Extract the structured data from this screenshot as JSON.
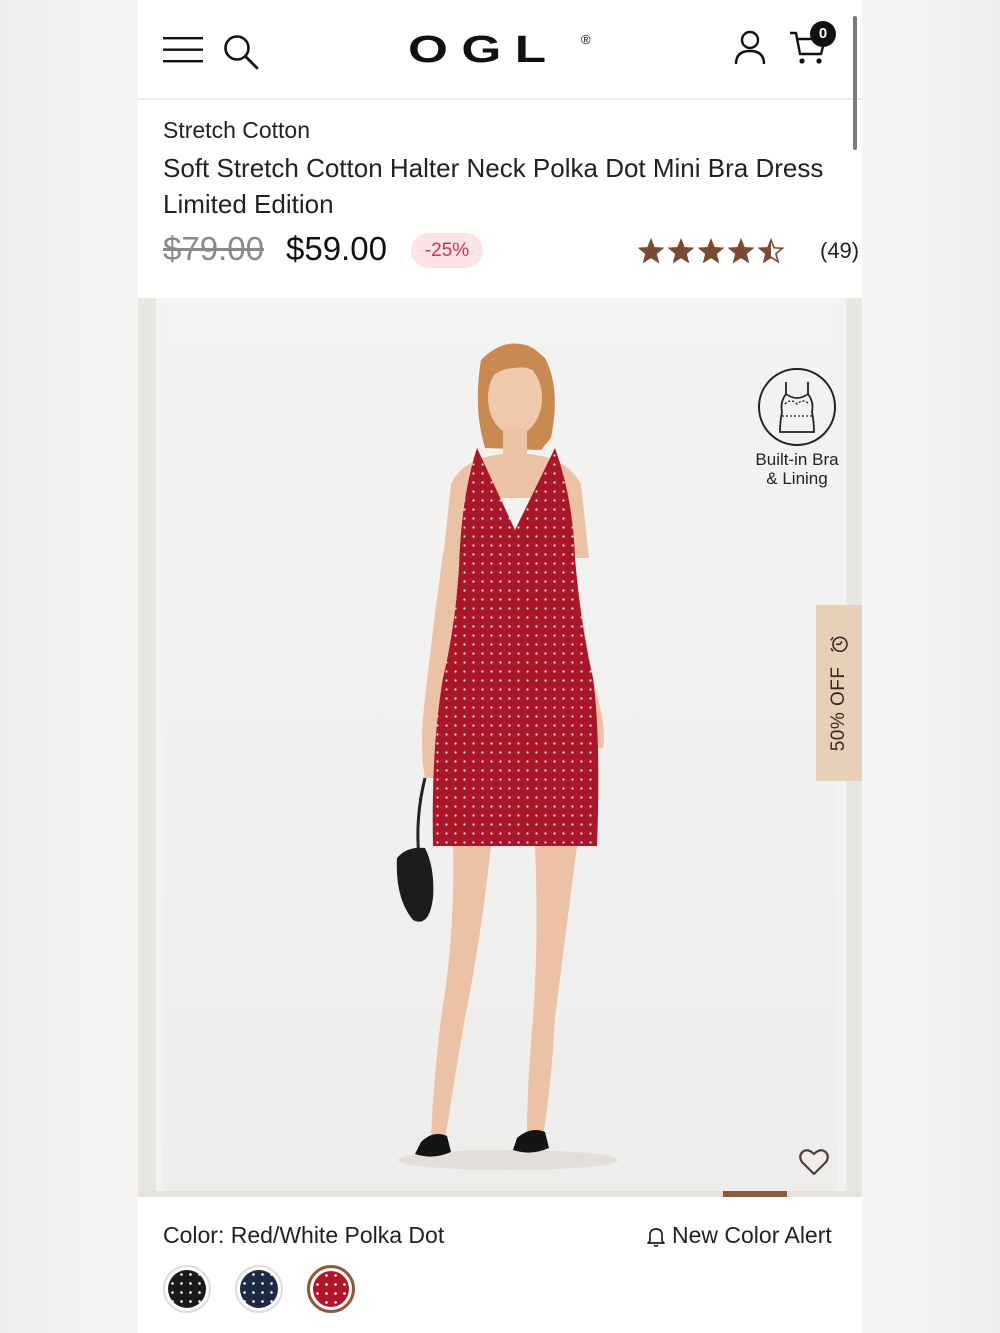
{
  "header": {
    "logo_text": "OGL",
    "logo_mark": "®",
    "cart_count": "0",
    "icons": [
      "menu-icon",
      "search-icon",
      "account-icon",
      "cart-icon"
    ]
  },
  "product": {
    "category": "Stretch Cotton",
    "title": "Soft Stretch Cotton Halter Neck Polka Dot Mini Bra Dress Limited Edition",
    "old_price": "$79.00",
    "price": "$59.00",
    "discount": "-25%",
    "rating_value": 4.5,
    "rating_max": 5,
    "review_count": "(49)"
  },
  "gallery": {
    "feature_badge": "Built-in Bra\n& Lining",
    "sale_tab": "50% OFF",
    "slide_index": 8,
    "slide_total": 10
  },
  "options": {
    "color_label": "Color: Red/White Polka Dot",
    "alert_label": "New Color Alert",
    "swatches": [
      {
        "name": "Black Polka Dot",
        "color": "#1a1a1a",
        "dot": "#ffffff"
      },
      {
        "name": "Navy Polka Dot",
        "color": "#1e2a44",
        "dot": "#ffffff"
      },
      {
        "name": "Red/White Polka Dot",
        "color": "#b0152a",
        "dot": "#ffffff",
        "selected": true
      }
    ]
  },
  "colors": {
    "accent": "#8b5a3c",
    "star": "#7a4a34",
    "discount_text": "#c9374f",
    "discount_bg": "#fbe3e6",
    "sale_tab_bg": "#e8cfb8",
    "dress": "#a8162a"
  }
}
